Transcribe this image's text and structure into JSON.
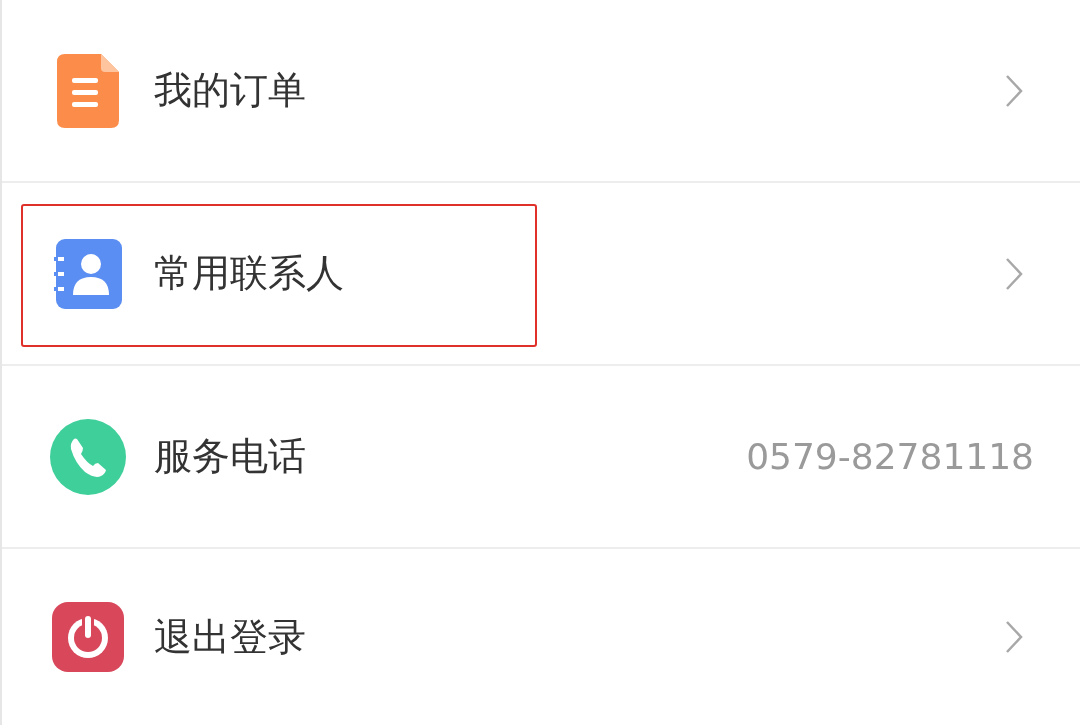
{
  "menu": [
    {
      "kind": "document",
      "label": "我的订单",
      "highlighted": false
    },
    {
      "kind": "contact",
      "label": "常用联系人",
      "highlighted": true
    },
    {
      "kind": "phone",
      "label": "服务电话",
      "value": "0579-82781118",
      "highlighted": false
    },
    {
      "kind": "power",
      "label": "退出登录",
      "highlighted": false
    }
  ]
}
